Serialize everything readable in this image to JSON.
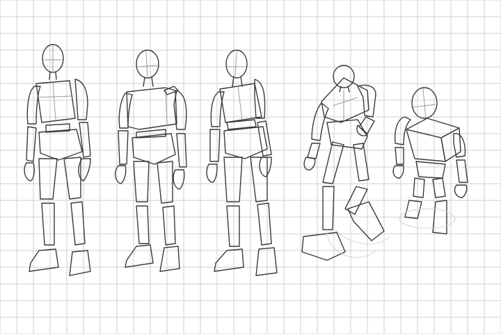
{
  "sheet": {
    "background": "#ffffff",
    "grid_color": "#cfcfcf",
    "line_color": "#3a3a3a"
  },
  "figures": [
    {
      "name": "mannequin-front"
    },
    {
      "name": "mannequin-three-quarter-left"
    },
    {
      "name": "mannequin-three-quarter-right"
    },
    {
      "name": "mannequin-low-angle"
    },
    {
      "name": "mannequin-high-angle"
    }
  ]
}
